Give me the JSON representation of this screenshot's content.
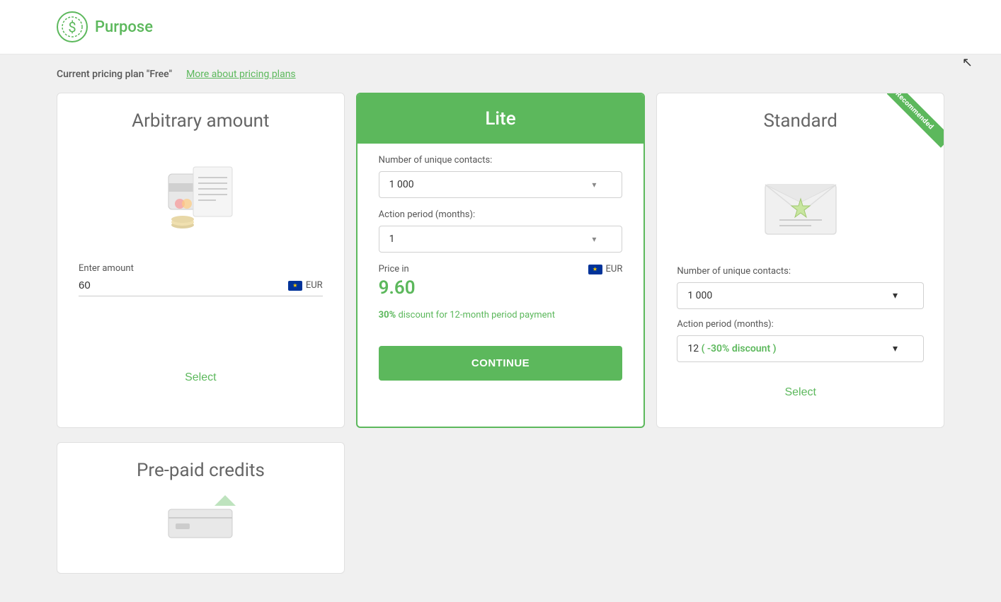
{
  "app": {
    "logo_text": "Purpose",
    "cursor": "›"
  },
  "pricing_bar": {
    "current_plan_label": "Current pricing plan \"Free\"",
    "more_plans_label": "More about pricing plans"
  },
  "cards": {
    "arbitrary": {
      "title": "Arbitrary amount",
      "enter_amount_label": "Enter amount",
      "amount_value": "60",
      "currency": "EUR",
      "select_label": "Select"
    },
    "lite": {
      "title": "Lite",
      "contacts_label": "Number of unique contacts:",
      "contacts_value": "1 000",
      "period_label": "Action period (months):",
      "period_value": "1",
      "price_in_label": "Price in",
      "currency": "EUR",
      "price_value": "9.60",
      "discount_note": "30% discount for 12-month period payment",
      "discount_percent": "30%",
      "continue_label": "CONTINUE"
    },
    "standard": {
      "title": "Standard",
      "recommended_label": "Recommended",
      "contacts_label": "Number of unique contacts:",
      "contacts_value": "1 000",
      "period_label": "Action period (months):",
      "period_value": "12",
      "discount_text": "( -30% discount )",
      "select_label": "Select"
    }
  },
  "bottom_cards": {
    "prepaid": {
      "title": "Pre-paid credits"
    }
  }
}
